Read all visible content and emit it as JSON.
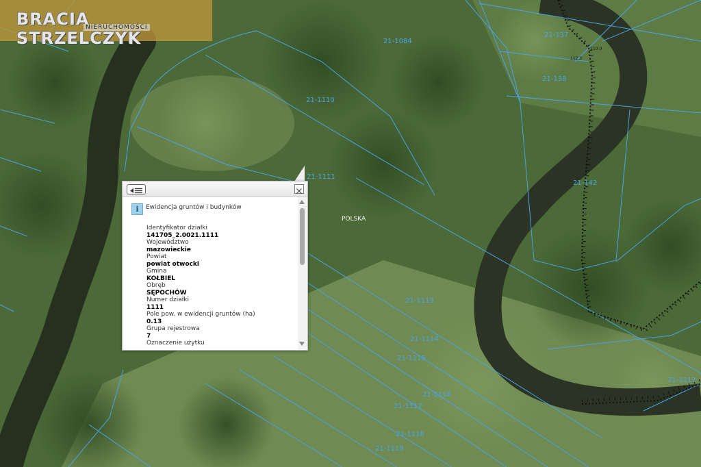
{
  "logo": {
    "name": "BRACIA STRZELCZYK",
    "tagline": "NIERUCHOMOŚCI"
  },
  "map": {
    "country_label": "POLSKA",
    "contour_labels": [
      "110.0",
      "112.3"
    ],
    "parcel_labels": [
      "21-1084",
      "21-137",
      "21-138",
      "21-1110",
      "21-1111",
      "21-142",
      "21-1113",
      "21-1114",
      "21-1115",
      "21-1116",
      "21-1117",
      "21-1118",
      "21-1119",
      "21-1112"
    ],
    "colors": {
      "parcel_line": "#4aa3e6",
      "boundary_line": "#111111"
    }
  },
  "popup": {
    "layer_title": "Ewidencja gruntów i budynków",
    "icons": {
      "menu": "list-menu-icon",
      "close": "close-icon",
      "info": "info-icon"
    },
    "fields": [
      {
        "label": "Identyfikator działki",
        "value": "141705_2.0021.1111"
      },
      {
        "label": "Województwo",
        "value": "mazowieckie"
      },
      {
        "label": "Powiat",
        "value": "powiat otwocki"
      },
      {
        "label": "Gmina",
        "value": "KOŁBIEL"
      },
      {
        "label": "Obręb",
        "value": "SĘPOCHÓW"
      },
      {
        "label": "Numer działki",
        "value": "1111"
      },
      {
        "label": "Pole pow. w ewidencji gruntów (ha)",
        "value": "0.13"
      },
      {
        "label": "Grupa rejestrowa",
        "value": "7"
      },
      {
        "label": "Oznaczenie użytku",
        "value": ""
      }
    ]
  }
}
